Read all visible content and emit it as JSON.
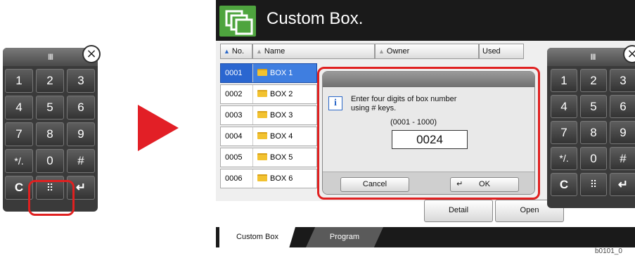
{
  "left_keypad": {
    "grip": "III",
    "close": "×",
    "keys": [
      "1",
      "2",
      "3",
      "4",
      "5",
      "6",
      "7",
      "8",
      "9",
      "*/.",
      "0",
      "#",
      "C",
      "⠿",
      "↵"
    ]
  },
  "screen": {
    "title": "Custom Box.",
    "columns": {
      "no": "No.",
      "name": "Name",
      "owner": "Owner",
      "used": "Used"
    },
    "rows": [
      {
        "no": "0001",
        "name": "BOX 1"
      },
      {
        "no": "0002",
        "name": "BOX 2"
      },
      {
        "no": "0003",
        "name": "BOX 3"
      },
      {
        "no": "0004",
        "name": "BOX 4"
      },
      {
        "no": "0005",
        "name": "BOX 5"
      },
      {
        "no": "0006",
        "name": "BOX 6"
      }
    ],
    "detail_label": "Detail",
    "open_label": "Open",
    "tabs": {
      "custom_box": "Custom Box",
      "program": "Program"
    }
  },
  "dialog": {
    "message_line1": "Enter four digits of box number",
    "message_line2": "using # keys.",
    "range": "(0001 - 1000)",
    "value": "0024",
    "cancel_label": "Cancel",
    "ok_label": "OK"
  },
  "right_keypad": {
    "grip": "III",
    "close": "×",
    "keys": [
      "1",
      "2",
      "3",
      "4",
      "5",
      "6",
      "7",
      "8",
      "9",
      "*/.",
      "0",
      "#",
      "C",
      "⠿",
      "↵"
    ]
  },
  "credit": "b0101_0",
  "colors": {
    "highlight_ring": "#e02020",
    "arrow": "#e21f26",
    "title_bar": "#1a1a1a",
    "selection": "#2a66d0",
    "icon_green": "#4ea43e"
  }
}
